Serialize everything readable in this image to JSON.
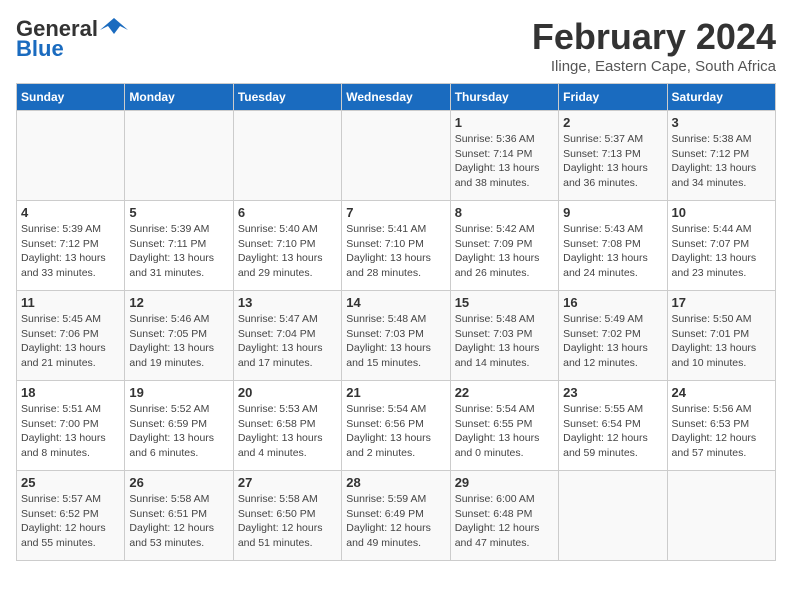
{
  "header": {
    "logo_general": "General",
    "logo_blue": "Blue",
    "month": "February 2024",
    "location": "Ilinge, Eastern Cape, South Africa"
  },
  "weekdays": [
    "Sunday",
    "Monday",
    "Tuesday",
    "Wednesday",
    "Thursday",
    "Friday",
    "Saturday"
  ],
  "weeks": [
    [
      {
        "day": "",
        "info": ""
      },
      {
        "day": "",
        "info": ""
      },
      {
        "day": "",
        "info": ""
      },
      {
        "day": "",
        "info": ""
      },
      {
        "day": "1",
        "info": "Sunrise: 5:36 AM\nSunset: 7:14 PM\nDaylight: 13 hours\nand 38 minutes."
      },
      {
        "day": "2",
        "info": "Sunrise: 5:37 AM\nSunset: 7:13 PM\nDaylight: 13 hours\nand 36 minutes."
      },
      {
        "day": "3",
        "info": "Sunrise: 5:38 AM\nSunset: 7:12 PM\nDaylight: 13 hours\nand 34 minutes."
      }
    ],
    [
      {
        "day": "4",
        "info": "Sunrise: 5:39 AM\nSunset: 7:12 PM\nDaylight: 13 hours\nand 33 minutes."
      },
      {
        "day": "5",
        "info": "Sunrise: 5:39 AM\nSunset: 7:11 PM\nDaylight: 13 hours\nand 31 minutes."
      },
      {
        "day": "6",
        "info": "Sunrise: 5:40 AM\nSunset: 7:10 PM\nDaylight: 13 hours\nand 29 minutes."
      },
      {
        "day": "7",
        "info": "Sunrise: 5:41 AM\nSunset: 7:10 PM\nDaylight: 13 hours\nand 28 minutes."
      },
      {
        "day": "8",
        "info": "Sunrise: 5:42 AM\nSunset: 7:09 PM\nDaylight: 13 hours\nand 26 minutes."
      },
      {
        "day": "9",
        "info": "Sunrise: 5:43 AM\nSunset: 7:08 PM\nDaylight: 13 hours\nand 24 minutes."
      },
      {
        "day": "10",
        "info": "Sunrise: 5:44 AM\nSunset: 7:07 PM\nDaylight: 13 hours\nand 23 minutes."
      }
    ],
    [
      {
        "day": "11",
        "info": "Sunrise: 5:45 AM\nSunset: 7:06 PM\nDaylight: 13 hours\nand 21 minutes."
      },
      {
        "day": "12",
        "info": "Sunrise: 5:46 AM\nSunset: 7:05 PM\nDaylight: 13 hours\nand 19 minutes."
      },
      {
        "day": "13",
        "info": "Sunrise: 5:47 AM\nSunset: 7:04 PM\nDaylight: 13 hours\nand 17 minutes."
      },
      {
        "day": "14",
        "info": "Sunrise: 5:48 AM\nSunset: 7:03 PM\nDaylight: 13 hours\nand 15 minutes."
      },
      {
        "day": "15",
        "info": "Sunrise: 5:48 AM\nSunset: 7:03 PM\nDaylight: 13 hours\nand 14 minutes."
      },
      {
        "day": "16",
        "info": "Sunrise: 5:49 AM\nSunset: 7:02 PM\nDaylight: 13 hours\nand 12 minutes."
      },
      {
        "day": "17",
        "info": "Sunrise: 5:50 AM\nSunset: 7:01 PM\nDaylight: 13 hours\nand 10 minutes."
      }
    ],
    [
      {
        "day": "18",
        "info": "Sunrise: 5:51 AM\nSunset: 7:00 PM\nDaylight: 13 hours\nand 8 minutes."
      },
      {
        "day": "19",
        "info": "Sunrise: 5:52 AM\nSunset: 6:59 PM\nDaylight: 13 hours\nand 6 minutes."
      },
      {
        "day": "20",
        "info": "Sunrise: 5:53 AM\nSunset: 6:58 PM\nDaylight: 13 hours\nand 4 minutes."
      },
      {
        "day": "21",
        "info": "Sunrise: 5:54 AM\nSunset: 6:56 PM\nDaylight: 13 hours\nand 2 minutes."
      },
      {
        "day": "22",
        "info": "Sunrise: 5:54 AM\nSunset: 6:55 PM\nDaylight: 13 hours\nand 0 minutes."
      },
      {
        "day": "23",
        "info": "Sunrise: 5:55 AM\nSunset: 6:54 PM\nDaylight: 12 hours\nand 59 minutes."
      },
      {
        "day": "24",
        "info": "Sunrise: 5:56 AM\nSunset: 6:53 PM\nDaylight: 12 hours\nand 57 minutes."
      }
    ],
    [
      {
        "day": "25",
        "info": "Sunrise: 5:57 AM\nSunset: 6:52 PM\nDaylight: 12 hours\nand 55 minutes."
      },
      {
        "day": "26",
        "info": "Sunrise: 5:58 AM\nSunset: 6:51 PM\nDaylight: 12 hours\nand 53 minutes."
      },
      {
        "day": "27",
        "info": "Sunrise: 5:58 AM\nSunset: 6:50 PM\nDaylight: 12 hours\nand 51 minutes."
      },
      {
        "day": "28",
        "info": "Sunrise: 5:59 AM\nSunset: 6:49 PM\nDaylight: 12 hours\nand 49 minutes."
      },
      {
        "day": "29",
        "info": "Sunrise: 6:00 AM\nSunset: 6:48 PM\nDaylight: 12 hours\nand 47 minutes."
      },
      {
        "day": "",
        "info": ""
      },
      {
        "day": "",
        "info": ""
      }
    ]
  ]
}
